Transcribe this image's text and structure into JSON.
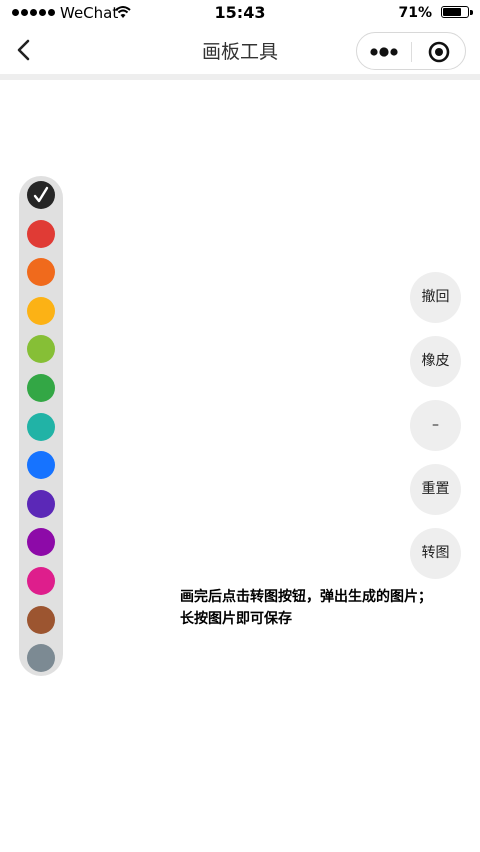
{
  "status_bar": {
    "carrier": "WeChat",
    "time": "15:43",
    "battery_percent": "71%",
    "battery_level": 0.71,
    "icons": [
      "signal-dots-icon",
      "wifi-icon",
      "battery-icon"
    ]
  },
  "nav": {
    "title": "画板工具",
    "icons": [
      "back-arrow-icon",
      "more-dots-icon",
      "target-icon"
    ]
  },
  "palette": {
    "selected_index": 0,
    "colors": [
      "#262626",
      "#e03b35",
      "#f06a1c",
      "#fcb215",
      "#86bf36",
      "#33a745",
      "#21b3a6",
      "#1673ff",
      "#5b28b7",
      "#8d0aa8",
      "#de1e8c",
      "#9c5530",
      "#7c8a93"
    ]
  },
  "tools": {
    "undo": "撤回",
    "eraser": "橡皮",
    "minus": "–",
    "reset": "重置",
    "convert": "转图"
  },
  "hint": {
    "line1": "画完后点击转图按钮，弹出生成的图片；",
    "line2": "长按图片即可保存"
  }
}
